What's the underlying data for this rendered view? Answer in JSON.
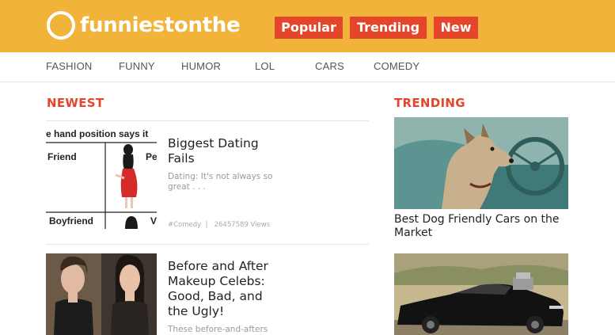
{
  "header": {
    "logo_text": "funniestonthe",
    "buttons": [
      "Popular",
      "Trending",
      "New"
    ]
  },
  "nav": {
    "items": [
      "FASHION",
      "FUNNY",
      "HUMOR",
      "LOL",
      "CARS",
      "COMEDY"
    ]
  },
  "newest": {
    "heading": "NEWEST",
    "articles": [
      {
        "title_lines": [
          "Biggest Dating",
          "Fails"
        ],
        "desc_lines": [
          "Dating: It's not always so",
          "great . . ."
        ],
        "category": "#Comedy",
        "views": "26457589 Views",
        "thumb_text": {
          "top": "e hand position says it",
          "left_label": "Friend",
          "right_label": "Pe",
          "bottom_label": "Boyfriend",
          "bottom_right": "V"
        }
      },
      {
        "title_lines": [
          "Before and After",
          "Makeup Celebs:",
          "Good, Bad, and",
          "the Ugly!"
        ],
        "desc_lines": [
          "These before-and-afters"
        ]
      }
    ]
  },
  "trending": {
    "heading": "TRENDING",
    "items": [
      {
        "title_lines": [
          "Best Dog Friendly Cars on the",
          "Market"
        ]
      },
      {
        "title_lines": []
      }
    ]
  },
  "colors": {
    "header_bg": "#f2b33a",
    "accent": "#e4452b"
  }
}
